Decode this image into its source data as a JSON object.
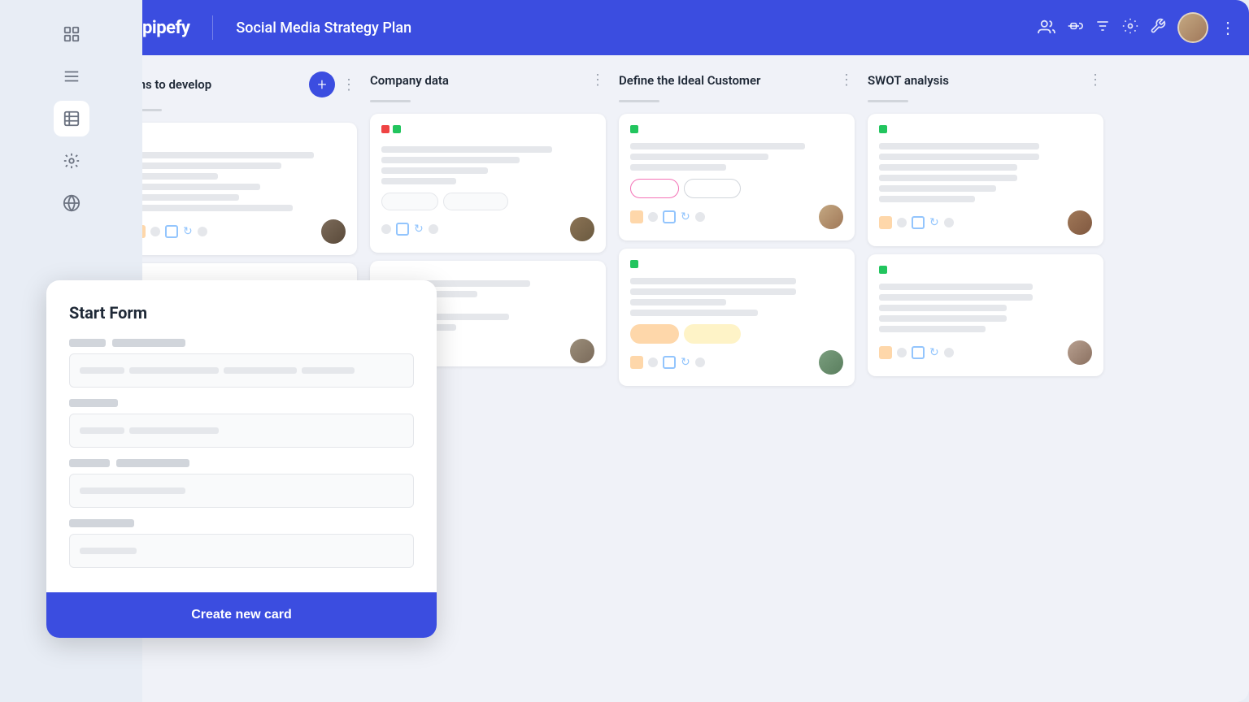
{
  "app": {
    "title": "Social Media Strategy Plan",
    "logo": "pipefy"
  },
  "header": {
    "title": "Social Media Strategy Plan",
    "actions": {
      "people_icon": "👥",
      "share_icon": "↗",
      "filter_icon": "⊟",
      "settings_icon": "⚙",
      "tool_icon": "🔧",
      "more_icon": "⋮"
    }
  },
  "sidebar": {
    "items": [
      {
        "icon": "grid",
        "label": "Dashboard",
        "active": false
      },
      {
        "icon": "list",
        "label": "List",
        "active": false
      },
      {
        "icon": "table",
        "label": "Table",
        "active": true
      },
      {
        "icon": "robot",
        "label": "Automation",
        "active": false
      },
      {
        "icon": "globe",
        "label": "Public",
        "active": false
      }
    ]
  },
  "columns": [
    {
      "id": "plans",
      "title": "Plans to develop",
      "hasAddButton": true,
      "cards": [
        {
          "id": "card1",
          "dotColor": "red",
          "hasAvatar": true,
          "avatarClass": "av1"
        },
        {
          "id": "card2",
          "dotColor": "none",
          "hasAvatar": false,
          "partial": true
        }
      ]
    },
    {
      "id": "company",
      "title": "Company data",
      "cards": [
        {
          "id": "card3",
          "dotColors": [
            "red",
            "green"
          ],
          "hasBadges": true,
          "badge1": "outline-gray",
          "badge2": "outline-gray",
          "hasAvatar": true,
          "avatarClass": "av2"
        },
        {
          "id": "card4",
          "dotColor": "none",
          "hasAvatar": true,
          "avatarClass": "av3",
          "partial": true
        }
      ]
    },
    {
      "id": "ideal",
      "title": "Define the Ideal Customer",
      "cards": [
        {
          "id": "card5",
          "dotColor": "green",
          "hasBadges": true,
          "badge1": "outline-pink",
          "badge2": "outline-gray",
          "hasAvatar": true,
          "avatarClass": "av4"
        },
        {
          "id": "card6",
          "dotColor": "green",
          "hasBadges": true,
          "badge1": "outline-orange",
          "badge2": "outline-yellow",
          "hasAvatar": true,
          "avatarClass": "av5"
        }
      ]
    },
    {
      "id": "swot",
      "title": "SWOT analysis",
      "cards": [
        {
          "id": "card7",
          "dotColor": "green",
          "hasAvatar": true,
          "avatarClass": "av6"
        },
        {
          "id": "card8",
          "dotColor": "green",
          "hasAvatar": true,
          "avatarClass": "av7"
        }
      ]
    }
  ],
  "startForm": {
    "title": "Start Form",
    "field1": {
      "label1_width": "45px",
      "label2_width": "90px",
      "input_placeholders": [
        "short",
        "medium",
        "long",
        "tiny"
      ]
    },
    "field2": {
      "label_width": "60px"
    },
    "field3": {
      "label1_width": "50px",
      "label2_width": "90px"
    },
    "field4": {
      "label_width": "80px"
    },
    "createButton": "Create new card"
  }
}
